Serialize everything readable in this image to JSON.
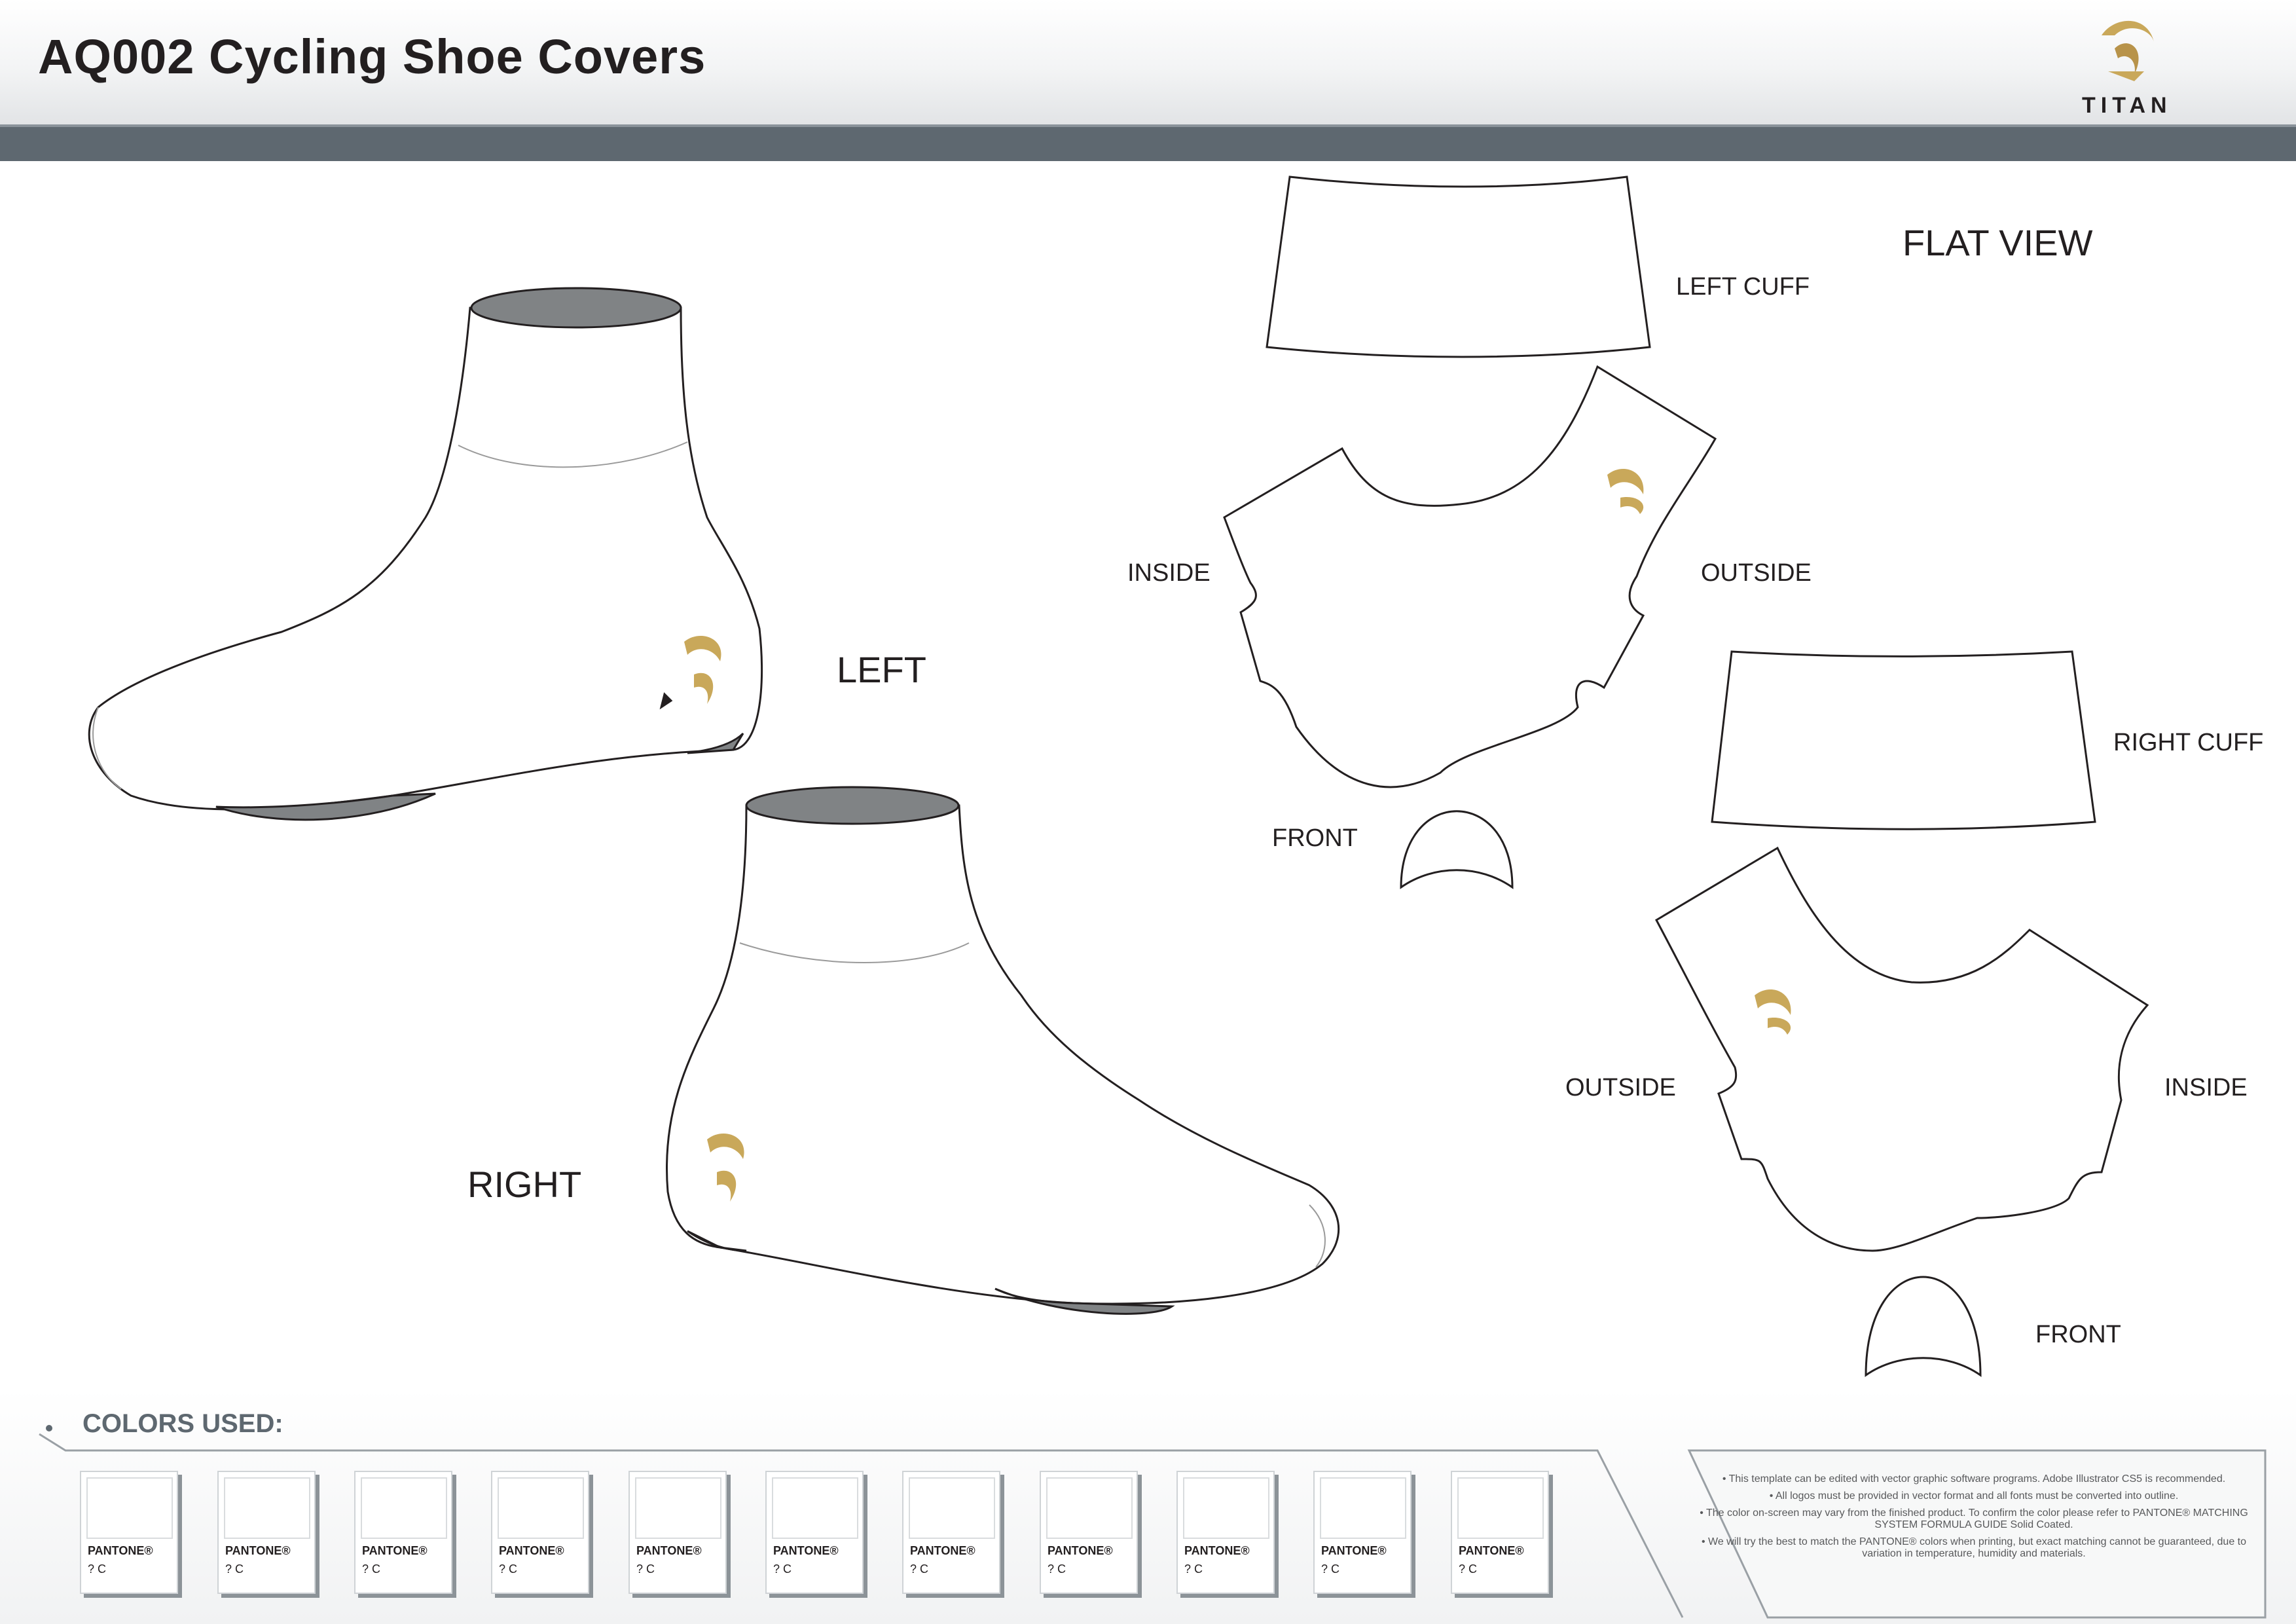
{
  "header": {
    "title": "AQ002 Cycling Shoe Covers",
    "brand": "TITAN"
  },
  "labels": {
    "left": "LEFT",
    "right": "RIGHT",
    "flat_view": "FLAT VIEW",
    "left_cuff": "LEFT CUFF",
    "right_cuff": "RIGHT CUFF",
    "inside_1": "INSIDE",
    "outside_1": "OUTSIDE",
    "front_1": "FRONT",
    "outside_2": "OUTSIDE",
    "inside_2": "INSIDE",
    "front_2": "FRONT"
  },
  "colors_used": {
    "title": "COLORS USED:",
    "swatches": [
      {
        "brand": "PANTONE®",
        "code": "? C"
      },
      {
        "brand": "PANTONE®",
        "code": "? C"
      },
      {
        "brand": "PANTONE®",
        "code": "? C"
      },
      {
        "brand": "PANTONE®",
        "code": "? C"
      },
      {
        "brand": "PANTONE®",
        "code": "? C"
      },
      {
        "brand": "PANTONE®",
        "code": "? C"
      },
      {
        "brand": "PANTONE®",
        "code": "? C"
      },
      {
        "brand": "PANTONE®",
        "code": "? C"
      },
      {
        "brand": "PANTONE®",
        "code": "? C"
      },
      {
        "brand": "PANTONE®",
        "code": "? C"
      },
      {
        "brand": "PANTONE®",
        "code": "? C"
      }
    ]
  },
  "notes": [
    "• This template can be edited with vector graphic software programs. Adobe Illustrator CS5 is recommended.",
    "• All logos must be provided in vector format and all fonts must be converted into outline.",
    "• The color on-screen may vary from the finished product. To confirm the color please refer to PANTONE® MATCHING SYSTEM FORMULA GUIDE Solid Coated.",
    "• We will try the best to match the PANTONE® colors when printing, but exact matching cannot be guaranteed, due to variation in temperature, humidity and materials."
  ],
  "palette": {
    "header_band": "#5e6870",
    "title_text": "#231f20",
    "sole_grey": "#808385",
    "logo_gold": "#c9a85a"
  }
}
